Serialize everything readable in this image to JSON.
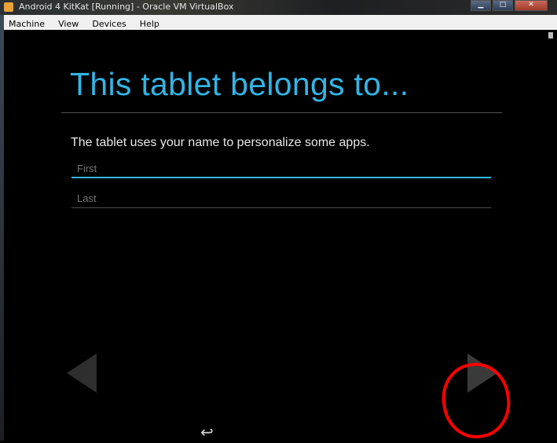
{
  "window": {
    "title": "Android 4 KitKat [Running] - Oracle VM VirtualBox",
    "buttons": {
      "minimize": "▁",
      "maximize": "□",
      "close": "✕"
    }
  },
  "menubar": {
    "items": [
      "Machine",
      "View",
      "Devices",
      "Help"
    ]
  },
  "setup": {
    "heading": "This tablet belongs to...",
    "description": "The tablet uses your name to personalize some apps.",
    "first_placeholder": "First",
    "last_placeholder": "Last"
  },
  "nav": {
    "prev_icon": "arrow-left-icon",
    "next_icon": "arrow-right-icon",
    "back_glyph": "↩"
  },
  "colors": {
    "accent": "#33b5e5",
    "annotation": "#ff0000",
    "background": "#000000"
  }
}
